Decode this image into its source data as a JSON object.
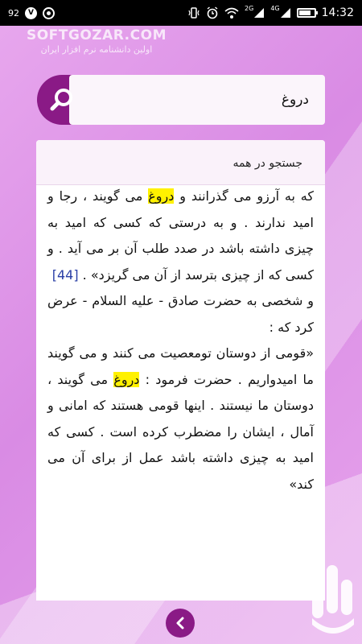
{
  "status_bar": {
    "left_icons": [
      "signal-92-icon",
      "v-circle-icon",
      "record-ring-icon"
    ],
    "left_text": "92",
    "v_text": "V",
    "net_2g": "2G",
    "net_4g": "4G",
    "time": "14:32"
  },
  "watermark": {
    "title": "SOFTGOZAR.COM",
    "subtitle": "اولین دانشنامه نرم افزار ایران"
  },
  "search": {
    "value": "دروغ",
    "icon": "search-icon"
  },
  "search_all_label": "جستجو در همه",
  "article": {
    "p1_a": "که به آرزو می گذرانند و ",
    "p1_hl": "دروغ",
    "p1_b": " می گویند ، رجا و امید ندارند . و به درستی که کسی که امید به چیزی داشته باشد در صدد طلب آن بر می آید . و کسی که از چیزی بترسد از آن می گریزد» . ",
    "p1_ref": "[44]",
    "p2": "و شخصی به حضرت صادق - علیه السلام - عرض کرد که :",
    "p3_a": "«قومی از دوستان تومعصیت می کنند و می گویند ما امیدواریم . حضرت فرمود : ",
    "p3_hl": "دروغ",
    "p3_b": " می گویند ، دوستان ما نیستند . اینها قومی هستند که امانی و آمال ، ایشان را مضطرب کرده است . کسی که امید به چیزی داشته باشد عمل از برای آن می کند»"
  },
  "colors": {
    "accent": "#8a1a86",
    "highlight": "#fff100",
    "reference": "#2a3fa6"
  }
}
